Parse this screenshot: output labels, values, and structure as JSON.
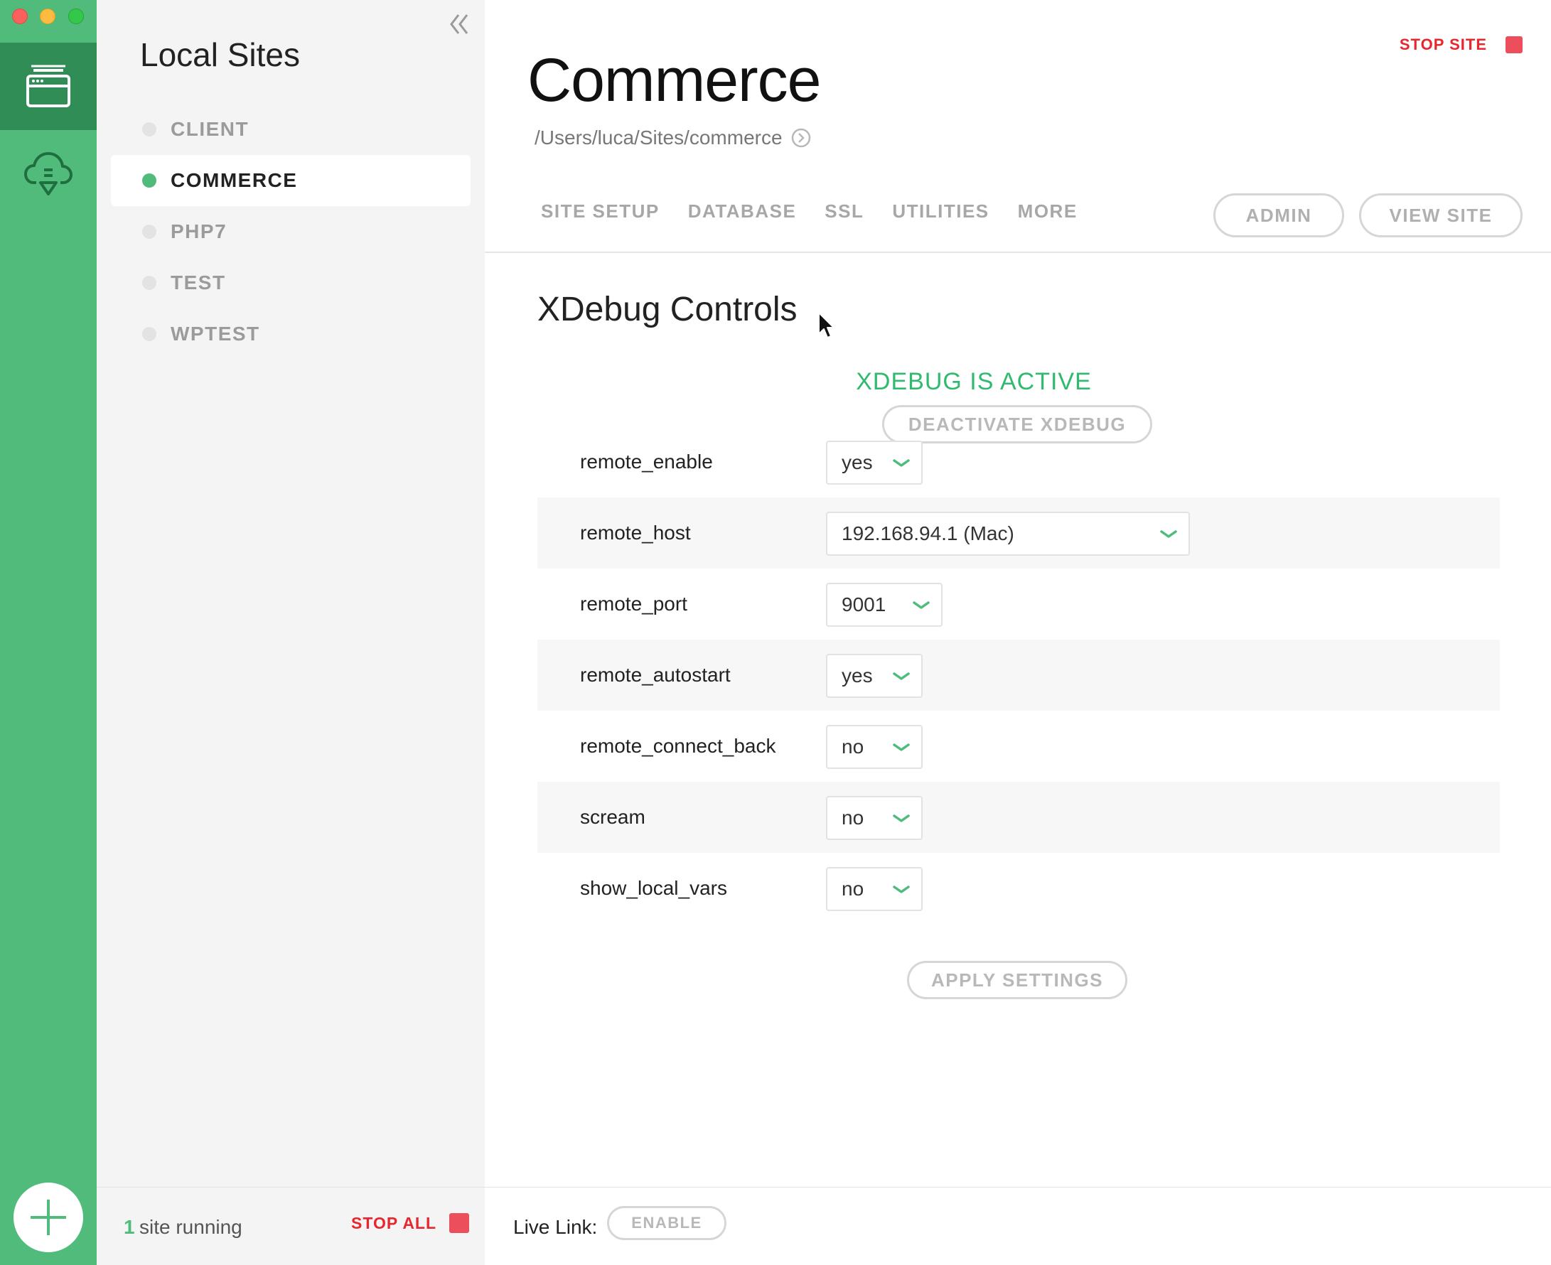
{
  "window": {
    "traffic_lights": [
      "close",
      "minimize",
      "maximize"
    ]
  },
  "rail": {
    "items": [
      {
        "icon": "sites-icon",
        "active": true
      },
      {
        "icon": "cloud-download-icon",
        "active": false
      }
    ],
    "add_button_icon": "plus-icon"
  },
  "sidebar": {
    "title": "Local Sites",
    "sites": [
      {
        "label": "CLIENT",
        "active": false
      },
      {
        "label": "COMMERCE",
        "active": true
      },
      {
        "label": "PHP7",
        "active": false
      },
      {
        "label": "TEST",
        "active": false
      },
      {
        "label": "WPTEST",
        "active": false
      }
    ],
    "footer": {
      "running_count": "1",
      "running_text": "site running",
      "stop_all_label": "STOP ALL"
    }
  },
  "main": {
    "stop_site_label": "STOP SITE",
    "site_title": "Commerce",
    "site_path": "/Users/luca/Sites/commerce",
    "tabs": [
      {
        "label": "SITE SETUP"
      },
      {
        "label": "DATABASE"
      },
      {
        "label": "SSL"
      },
      {
        "label": "UTILITIES"
      },
      {
        "label": "MORE"
      }
    ],
    "admin_label": "ADMIN",
    "view_site_label": "VIEW SITE",
    "section_title": "XDebug Controls",
    "xdebug_status": "XDEBUG IS ACTIVE",
    "deactivate_label": "DEACTIVATE XDEBUG",
    "settings": [
      {
        "name": "remote_enable",
        "value": "yes"
      },
      {
        "name": "remote_host",
        "value": "192.168.94.1 (Mac)"
      },
      {
        "name": "remote_port",
        "value": "9001"
      },
      {
        "name": "remote_autostart",
        "value": "yes"
      },
      {
        "name": "remote_connect_back",
        "value": "no"
      },
      {
        "name": "scream",
        "value": "no"
      },
      {
        "name": "show_local_vars",
        "value": "no"
      }
    ],
    "apply_label": "APPLY SETTINGS",
    "footer": {
      "live_link_label": "Live Link:",
      "enable_label": "ENABLE"
    }
  },
  "colors": {
    "brand_green": "#51bb7b",
    "brand_green_dark": "#2f8d55",
    "stop_red": "#e8262e",
    "status_green": "#2fba6f"
  }
}
